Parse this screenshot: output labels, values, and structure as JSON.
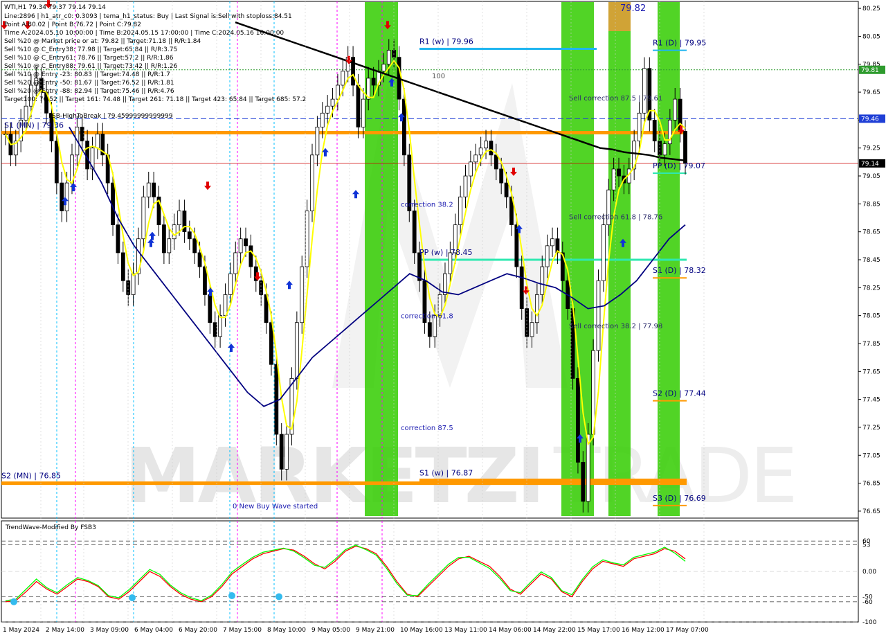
{
  "header": {
    "symbol_line": "WTI,H1  79.34 79.37 79.14 79.14",
    "lines": [
      "Line:2896 | h1_atr_c0: 0.3093 | tema_h1_status: Buy | Last Signal is:Sell with stoploss:84.51",
      "Point A:80.02 | Point B:76.72 | Point C:79.82",
      "Time A:2024.05.10 10:00:00 | Time B:2024.05.15 17:00:00 | Time C:2024.05.16 16:00:00",
      "Sell %20 @ Market price or at: 79.82 || Target:71.18 || R/R:1.84",
      "Sell %10 @ C_Entry38: 77.98 || Target:65.84 || R/R:3.75",
      "Sell %10 @ C_Entry61: 78.76 || Target:57.2 || R/R:1.86",
      "Sell %10 @ C_Entry88: 79.61 || Target:73.42 || R/R:1.26",
      "Sell %10 @ Entry -23: 80.83 || Target:74.48 || R/R:1.7",
      "Sell %20 @ Entry -50: 81.67 || Target:76.52 || R/R:1.81",
      "Sell %20 @ Entry -88: 82.94 || Target:75.46 || R/R:4.76",
      "Target100: 76.52 || Target 161: 74.48 || Target 261: 71.18 || Target 423: 65.84 || Target 685: 57.2",
      "FSB-HighToBreak | 79.45999999999999"
    ]
  },
  "chart_data": [
    {
      "type": "line",
      "title": "WTI,H1",
      "ylim": [
        76.6,
        80.3
      ],
      "y_ticks": [
        "80.25",
        "80.05",
        "79.85",
        "79.65",
        "79.45",
        "79.25",
        "79.05",
        "78.85",
        "78.65",
        "78.45",
        "78.25",
        "78.05",
        "77.85",
        "77.65",
        "77.45",
        "77.25",
        "77.05",
        "76.85",
        "76.65"
      ],
      "x_tick_labels": [
        "1 May 2024",
        "2 May 14:00",
        "3 May 09:00",
        "6 May 04:00",
        "6 May 20:00",
        "7 May 15:00",
        "8 May 10:00",
        "9 May 05:00",
        "9 May 21:00",
        "10 May 16:00",
        "13 May 11:00",
        "14 May 06:00",
        "14 May 22:00",
        "15 May 17:00",
        "16 May 12:00",
        "17 May 07:00"
      ],
      "price_badges": [
        {
          "value": 79.81,
          "text": "79.81",
          "color": "#2e9b2e"
        },
        {
          "value": 79.46,
          "text": "79.46",
          "color": "#1f3fd6"
        },
        {
          "value": 79.14,
          "text": "79.14",
          "color": "#000000"
        }
      ],
      "close": [
        79.35,
        79.2,
        79.3,
        79.45,
        79.55,
        79.7,
        79.75,
        79.65,
        79.5,
        79.3,
        79.0,
        78.8,
        79.0,
        79.2,
        79.4,
        79.3,
        79.1,
        79.25,
        79.35,
        79.2,
        79.0,
        78.7,
        78.5,
        78.3,
        78.2,
        78.35,
        78.6,
        78.9,
        79.0,
        78.9,
        78.7,
        78.5,
        78.6,
        78.7,
        78.8,
        78.65,
        78.6,
        78.5,
        78.4,
        78.2,
        78.0,
        77.9,
        78.05,
        78.2,
        78.35,
        78.5,
        78.6,
        78.55,
        78.4,
        78.3,
        78.2,
        78.0,
        77.7,
        77.2,
        76.95,
        77.2,
        77.6,
        78.0,
        78.4,
        78.8,
        79.2,
        79.4,
        79.5,
        79.55,
        79.6,
        79.7,
        79.8,
        79.9,
        79.7,
        79.4,
        79.6,
        79.75,
        79.7,
        79.8,
        79.85,
        79.95,
        79.9,
        79.6,
        79.2,
        78.8,
        78.5,
        78.3,
        78.0,
        77.9,
        78.05,
        78.2,
        78.35,
        78.5,
        78.7,
        78.9,
        79.05,
        79.15,
        79.2,
        79.25,
        79.3,
        79.2,
        79.1,
        79.0,
        78.9,
        78.7,
        78.4,
        78.1,
        77.9,
        78.0,
        78.2,
        78.4,
        78.55,
        78.6,
        78.5,
        78.3,
        78.1,
        77.6,
        77.0,
        76.72,
        77.2,
        77.8,
        78.3,
        78.7,
        78.95,
        79.1,
        79.05,
        79.0,
        79.1,
        79.3,
        79.5,
        79.82,
        79.45,
        79.3,
        79.2,
        79.28,
        79.45,
        79.6,
        79.37,
        79.14
      ],
      "ema_slow": [
        80.15,
        80.12,
        80.09,
        80.06,
        80.03,
        80.0,
        79.97,
        79.94,
        79.91,
        79.88,
        79.85,
        79.82,
        79.79,
        79.76,
        79.73,
        79.7,
        79.67,
        79.64,
        79.61,
        79.58,
        79.55,
        79.52,
        79.49,
        79.46,
        79.43,
        79.4,
        79.37,
        79.34,
        79.31,
        79.28,
        79.25,
        79.24,
        79.22,
        79.21,
        79.2,
        79.18,
        79.17,
        79.16
      ],
      "blue_ma": [
        79.4,
        79.2,
        79.0,
        78.75,
        78.55,
        78.4,
        78.25,
        78.1,
        77.95,
        77.8,
        77.65,
        77.5,
        77.4,
        77.45,
        77.6,
        77.75,
        77.85,
        77.95,
        78.05,
        78.15,
        78.25,
        78.35,
        78.3,
        78.22,
        78.2,
        78.25,
        78.3,
        78.35,
        78.32,
        78.28,
        78.25,
        78.18,
        78.1,
        78.12,
        78.2,
        78.3,
        78.45,
        78.6,
        78.7
      ],
      "levels": [
        {
          "label": "R1 (w) | 79.96",
          "value": 79.96,
          "color": "#1fb5f0"
        },
        {
          "label": "R1 (D) | 79.95",
          "value": 79.95,
          "color": "#1fb5f0"
        },
        {
          "label": "S1 (MN) | 79.36",
          "value": 79.36,
          "color": "#ff9900"
        },
        {
          "label": "PP (D) | 79.07",
          "value": 79.07,
          "color": "#2ee8b0"
        },
        {
          "label": "PP (w) | 78.45",
          "value": 78.45,
          "color": "#2ee8b0"
        },
        {
          "label": "S1 (D) | 78.32",
          "value": 78.32,
          "color": "#ff9900"
        },
        {
          "label": "S2 (D) | 77.44",
          "value": 77.44,
          "color": "#ff9900"
        },
        {
          "label": "S1 (w) | 76.87",
          "value": 76.87,
          "color": "#ff9900"
        },
        {
          "label": "S2 (MN) | 76.85",
          "value": 76.85,
          "color": "#ff9900"
        },
        {
          "label": "S3 (D) | 76.69",
          "value": 76.69,
          "color": "#ff9900"
        }
      ],
      "annotations": [
        {
          "text": "Sell correction 87.5 | 79.61",
          "value": 79.61
        },
        {
          "text": "Sell correction 61.8 | 78.76",
          "value": 78.76
        },
        {
          "text": "Sell correction 38.2 | 77.98",
          "value": 77.98
        },
        {
          "text": "correction 38.2",
          "value": 78.85
        },
        {
          "text": "correction 61.8",
          "value": 78.05
        },
        {
          "text": "correction 87.5",
          "value": 77.25
        },
        {
          "text": "0 New Buy Wave started",
          "value": 76.69
        },
        {
          "text": "100",
          "value": 79.77
        },
        {
          "text": "79.82",
          "value": 80.25
        }
      ]
    },
    {
      "type": "line",
      "title": "TrendWave-Modified By FSB3",
      "ylim": [
        -100,
        100
      ],
      "y_ticks": [
        "60",
        "53",
        "0.00",
        "-50",
        "-60",
        "-100"
      ],
      "series": [
        {
          "color": "#ff0000",
          "values": [
            -60,
            -58,
            -40,
            -20,
            -35,
            -45,
            -30,
            -15,
            -20,
            -30,
            -50,
            -55,
            -40,
            -20,
            0,
            -10,
            -30,
            -45,
            -55,
            -60,
            -50,
            -30,
            -5,
            10,
            25,
            35,
            40,
            45,
            42,
            30,
            15,
            5,
            20,
            40,
            50,
            45,
            35,
            10,
            -20,
            -45,
            -50,
            -30,
            -10,
            10,
            25,
            30,
            20,
            10,
            -10,
            -35,
            -45,
            -25,
            -5,
            -15,
            -40,
            -50,
            -20,
            5,
            20,
            15,
            10,
            25,
            30,
            35,
            45,
            40,
            25
          ]
        },
        {
          "color": "#00ff00",
          "values": [
            -58,
            -55,
            -35,
            -15,
            -32,
            -42,
            -26,
            -12,
            -18,
            -28,
            -48,
            -52,
            -36,
            -16,
            4,
            -6,
            -27,
            -42,
            -52,
            -58,
            -47,
            -26,
            -1,
            14,
            28,
            38,
            42,
            46,
            40,
            27,
            12,
            8,
            24,
            43,
            52,
            43,
            32,
            6,
            -24,
            -47,
            -48,
            -26,
            -6,
            14,
            28,
            28,
            17,
            6,
            -14,
            -38,
            -42,
            -21,
            -1,
            -12,
            -38,
            -46,
            -16,
            9,
            23,
            17,
            13,
            28,
            33,
            38,
            48,
            36,
            20
          ]
        }
      ]
    }
  ]
}
